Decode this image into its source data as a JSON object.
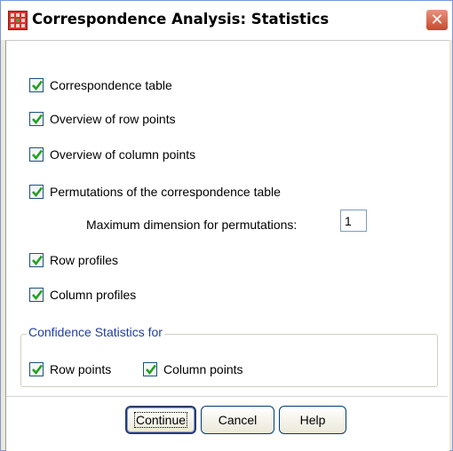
{
  "window": {
    "title": "Correspondence Analysis: Statistics",
    "icon": "spss-grid-icon",
    "close_icon": "close-x-icon"
  },
  "options": [
    {
      "key": "correspondence_table",
      "label": "Correspondence table",
      "checked": true
    },
    {
      "key": "overview_row_points",
      "label": "Overview of row points",
      "checked": true
    },
    {
      "key": "overview_column_points",
      "label": "Overview of column points",
      "checked": true
    },
    {
      "key": "permutations",
      "label": "Permutations of the correspondence table",
      "checked": true
    },
    {
      "key": "row_profiles",
      "label": "Row profiles",
      "checked": true
    },
    {
      "key": "column_profiles",
      "label": "Column profiles",
      "checked": true
    }
  ],
  "permutations": {
    "max_dimension_label": "Maximum dimension for permutations:",
    "max_dimension_value": "1"
  },
  "confidence": {
    "legend": "Confidence Statistics for",
    "row_points": {
      "label": "Row points",
      "checked": true
    },
    "column_points": {
      "label": "Column points",
      "checked": true
    }
  },
  "buttons": {
    "continue": "Continue",
    "cancel": "Cancel",
    "help": "Help"
  },
  "colors": {
    "check_mark": "#21a121",
    "legend_text": "#1e3e9f",
    "close_button": "#c74a2b"
  }
}
